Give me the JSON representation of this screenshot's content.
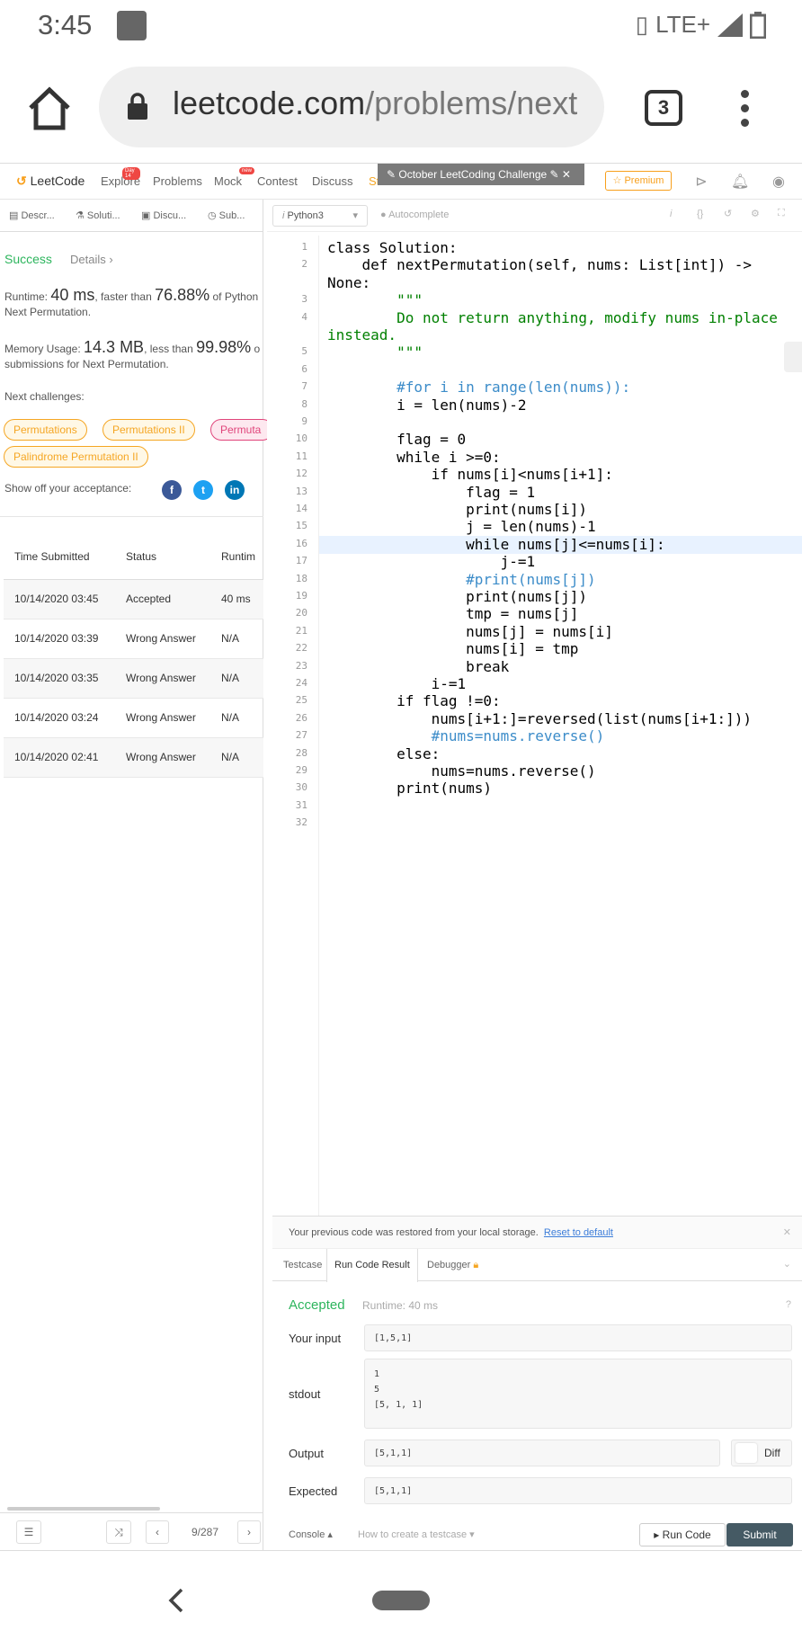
{
  "status": {
    "time": "3:45",
    "network": "LTE+"
  },
  "browser": {
    "url_host": "leetcode.com",
    "url_path": "/problems/next",
    "tab_count": "3"
  },
  "nav": {
    "logo": "LeetCode",
    "items": [
      "Explore",
      "Problems",
      "Mock",
      "Contest",
      "Discuss",
      "Store"
    ],
    "explore_badge": "Day 14",
    "mock_badge": "new",
    "challenge": "October LeetCoding Challenge",
    "premium": "Premium"
  },
  "left": {
    "tabs": [
      "Descr...",
      "Soluti...",
      "Discu...",
      "Sub..."
    ],
    "result": "Success",
    "details": "Details",
    "runtime_prefix": "Runtime: ",
    "runtime_value": "40 ms",
    "runtime_mid": ", faster than ",
    "runtime_pct": "76.88%",
    "runtime_suffix": " of Python",
    "runtime_line2": "Next Permutation.",
    "memory_prefix": "Memory Usage: ",
    "memory_value": "14.3 MB",
    "memory_mid": ", less than ",
    "memory_pct": "99.98%",
    "memory_suffix": " o",
    "memory_line2": "submissions for Next Permutation.",
    "next_challenges": "Next challenges:",
    "chips": [
      "Permutations",
      "Permutations II",
      "Permuta",
      "Palindrome Permutation II"
    ],
    "show_off": "Show off your acceptance:",
    "table_headers": [
      "Time Submitted",
      "Status",
      "Runtim"
    ],
    "rows": [
      {
        "time": "10/14/2020 03:45",
        "status": "Accepted",
        "runtime": "40 ms"
      },
      {
        "time": "10/14/2020 03:39",
        "status": "Wrong Answer",
        "runtime": "N/A"
      },
      {
        "time": "10/14/2020 03:35",
        "status": "Wrong Answer",
        "runtime": "N/A"
      },
      {
        "time": "10/14/2020 03:24",
        "status": "Wrong Answer",
        "runtime": "N/A"
      },
      {
        "time": "10/14/2020 02:41",
        "status": "Wrong Answer",
        "runtime": "N/A"
      }
    ],
    "page_counter": "9/287"
  },
  "editor": {
    "language": "Python3",
    "autocomplete": "Autocomplete",
    "line_numbers": [
      "1",
      "2",
      "3",
      "4",
      "5",
      "6",
      "7",
      "8",
      "9",
      "10",
      "11",
      "12",
      "13",
      "14",
      "15",
      "16",
      "17",
      "18",
      "19",
      "20",
      "21",
      "22",
      "23",
      "24",
      "25",
      "26",
      "27",
      "28",
      "29",
      "30",
      "31",
      "32"
    ],
    "code": [
      "class Solution:",
      "    def nextPermutation(self, nums: List[int]) ->",
      "None:",
      "        \"\"\"",
      "        Do not return anything, modify nums in-place",
      "instead.",
      "        \"\"\"",
      "",
      "        #for i in range(len(nums)):",
      "        i = len(nums)-2",
      "",
      "        flag = 0",
      "        while i >=0:",
      "            if nums[i]<nums[i+1]:",
      "                flag = 1",
      "                print(nums[i])",
      "                j = len(nums)-1",
      "                while nums[j]<=nums[i]:",
      "                    j-=1",
      "                #print(nums[j])",
      "                print(nums[j])",
      "                tmp = nums[j]",
      "                nums[j] = nums[i]",
      "                nums[i] = tmp",
      "                break",
      "            i-=1",
      "        if flag !=0:",
      "            nums[i+1:]=reversed(list(nums[i+1:]))",
      "            #nums=nums.reverse()",
      "        else:",
      "            nums=nums.reverse()",
      "        print(nums)"
    ]
  },
  "result": {
    "notice": "Your previous code was restored from your local storage.",
    "reset": "Reset to default",
    "tabs": [
      "Testcase",
      "Run Code Result",
      "Debugger"
    ],
    "status": "Accepted",
    "runtime": "Runtime: 40 ms",
    "your_input_label": "Your input",
    "your_input": "[1,5,1]",
    "stdout_label": "stdout",
    "stdout": "1\n5\n[5, 1, 1]",
    "output_label": "Output",
    "output": "[5,1,1]",
    "diff": "Diff",
    "expected_label": "Expected",
    "expected": "[5,1,1]"
  },
  "bottom": {
    "console": "Console",
    "howto": "How to create a testcase",
    "run": "Run Code",
    "submit": "Submit"
  }
}
